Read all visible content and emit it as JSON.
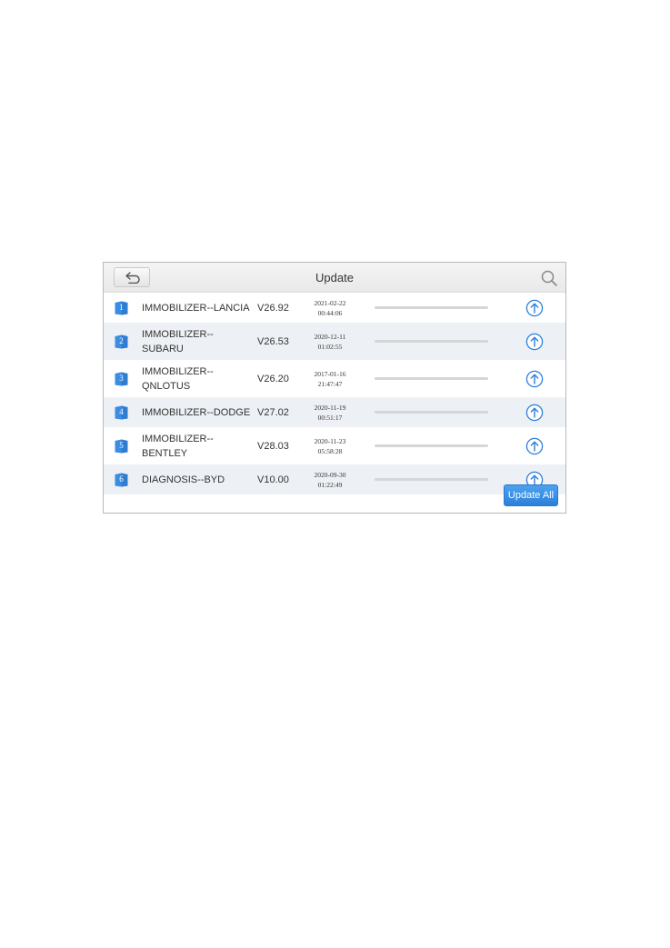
{
  "header": {
    "title": "Update",
    "back_icon": "back-arrow-icon",
    "search_icon": "search-icon"
  },
  "colors": {
    "accent": "#2b7fdb",
    "row_alt": "#edf1f5",
    "badge": "#3a8de2"
  },
  "items": [
    {
      "index": "1",
      "name": "IMMOBILIZER--LANCIA",
      "version": "V26.92",
      "date": "2021-02-22",
      "time": "00:44:06",
      "progress": 0
    },
    {
      "index": "2",
      "name": "IMMOBILIZER--SUBARU",
      "version": "V26.53",
      "date": "2020-12-11",
      "time": "01:02:55",
      "progress": 0
    },
    {
      "index": "3",
      "name": "IMMOBILIZER--QNLOTUS",
      "version": "V26.20",
      "date": "2017-01-16",
      "time": "21:47:47",
      "progress": 0
    },
    {
      "index": "4",
      "name": "IMMOBILIZER--DODGE",
      "version": "V27.02",
      "date": "2020-11-19",
      "time": "00:51:17",
      "progress": 0
    },
    {
      "index": "5",
      "name": "IMMOBILIZER--BENTLEY",
      "version": "V28.03",
      "date": "2020-11-23",
      "time": "05:58:28",
      "progress": 0
    },
    {
      "index": "6",
      "name": "DIAGNOSIS--BYD",
      "version": "V10.00",
      "date": "2020-09-30",
      "time": "01:22:49",
      "progress": 0
    }
  ],
  "footer": {
    "update_all_label": "Update All"
  }
}
